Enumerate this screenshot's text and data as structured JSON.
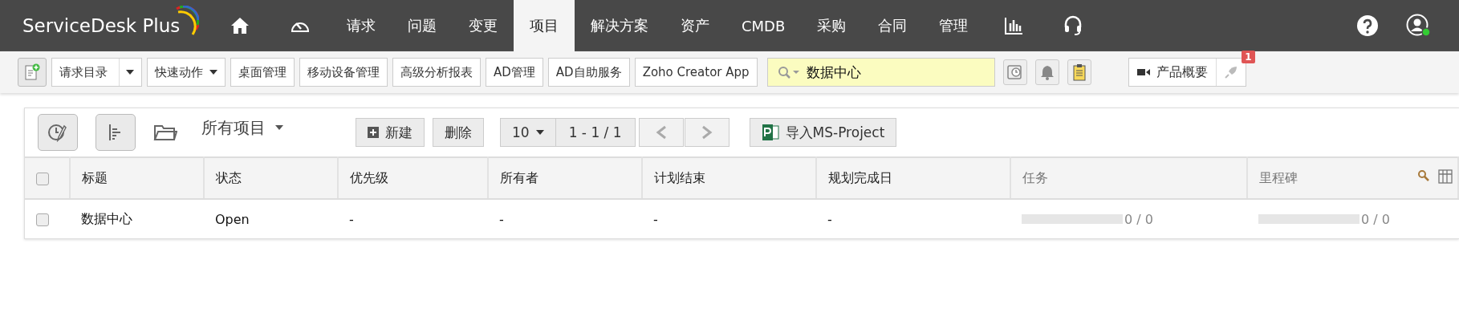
{
  "header": {
    "logo": "ServiceDesk Plus",
    "nav": [
      {
        "kind": "home",
        "selected": false
      },
      {
        "kind": "gauge",
        "selected": false
      },
      {
        "kind": "text",
        "label": "请求",
        "selected": false
      },
      {
        "kind": "text",
        "label": "问题",
        "selected": false
      },
      {
        "kind": "text",
        "label": "变更",
        "selected": false
      },
      {
        "kind": "text",
        "label": "项目",
        "selected": true
      },
      {
        "kind": "text",
        "label": "解决方案",
        "selected": false
      },
      {
        "kind": "text",
        "label": "资产",
        "selected": false
      },
      {
        "kind": "text",
        "label": "CMDB",
        "selected": false
      },
      {
        "kind": "text",
        "label": "采购",
        "selected": false
      },
      {
        "kind": "text",
        "label": "合同",
        "selected": false
      },
      {
        "kind": "text",
        "label": "管理",
        "selected": false
      },
      {
        "kind": "chart",
        "selected": false
      },
      {
        "kind": "headset",
        "selected": false
      }
    ]
  },
  "toolbar": {
    "items": [
      {
        "label": "请求目录",
        "dropdown": true,
        "split": true
      },
      {
        "label": "快速动作",
        "dropdown": true,
        "split": false
      },
      {
        "label": "桌面管理",
        "dropdown": false,
        "split": false
      },
      {
        "label": "移动设备管理",
        "dropdown": false,
        "split": false
      },
      {
        "label": "高级分析报表",
        "dropdown": false,
        "split": false
      },
      {
        "label": "AD管理",
        "dropdown": false,
        "split": false
      },
      {
        "label": "AD自助服务",
        "dropdown": false,
        "split": false
      },
      {
        "label": "Zoho Creator App",
        "dropdown": false,
        "split": false
      }
    ],
    "search": {
      "value": "数据中心"
    },
    "product_tour": "产品概要",
    "rocket_badge": "1"
  },
  "projects": {
    "view": "所有项目",
    "new_button": "新建",
    "delete_button": "删除",
    "page_size": "10",
    "range": "1 - 1 / 1",
    "import_button": "导入MS-Project",
    "select_all_checked": false,
    "columns": [
      "标题",
      "状态",
      "优先级",
      "所有者",
      "计划结束",
      "规划完成日",
      "任务",
      "里程碑"
    ],
    "rows": [
      {
        "checked": false,
        "title": "数据中心",
        "status": "Open",
        "priority": "-",
        "owner": "-",
        "planned_end": "-",
        "planned_completion": "-",
        "tasks": {
          "count": "0 / 0"
        },
        "milestones": {
          "count": "0 / 0"
        }
      }
    ]
  }
}
